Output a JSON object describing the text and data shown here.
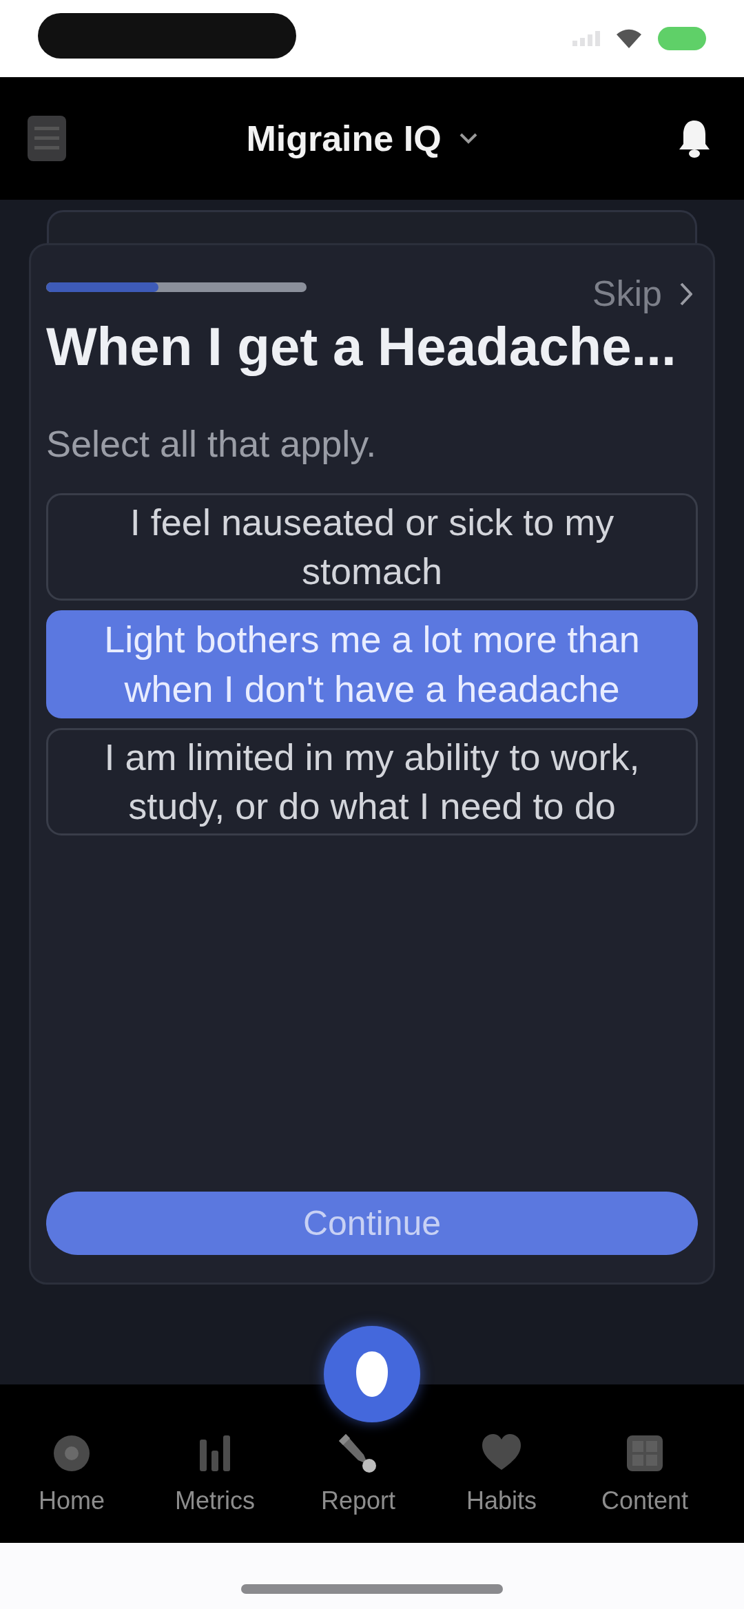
{
  "header": {
    "title": "Migraine IQ"
  },
  "question": {
    "progress": {
      "level": 0.43
    },
    "skip": "Skip",
    "title": "When I get a Headache...",
    "hint": "Select all that apply.",
    "options": [
      {
        "label": "I feel nauseated or sick to my stomach",
        "selected": false
      },
      {
        "label": "Light bothers me a lot more than when I don't have a headache",
        "selected": true
      },
      {
        "label": "I am limited in my ability to work, study, or do what I need to do",
        "selected": false
      }
    ],
    "continue": "Continue"
  },
  "nav": {
    "items": [
      {
        "label": "Home",
        "kind": "home"
      },
      {
        "label": "Metrics",
        "kind": "metrics"
      },
      {
        "label": "Report",
        "kind": "report"
      },
      {
        "label": "Habits",
        "kind": "habits"
      },
      {
        "label": "Content",
        "kind": "content"
      }
    ]
  }
}
